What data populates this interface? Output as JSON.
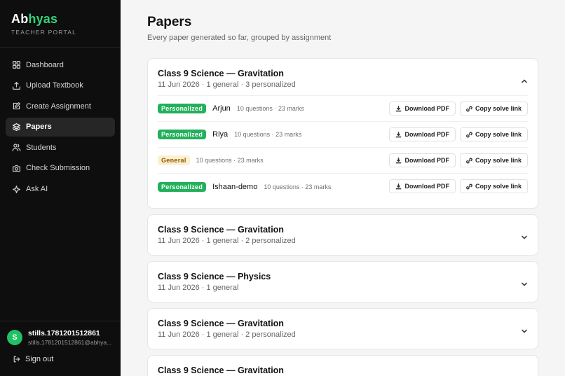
{
  "brand": {
    "name_part1": "Ab",
    "name_part2": "hyas",
    "subtitle": "TEACHER PORTAL",
    "accent_color": "#34d27b"
  },
  "sidebar": {
    "items": [
      {
        "label": "Dashboard",
        "icon": "grid-icon",
        "active": false
      },
      {
        "label": "Upload Textbook",
        "icon": "upload-icon",
        "active": false
      },
      {
        "label": "Create Assignment",
        "icon": "edit-icon",
        "active": false
      },
      {
        "label": "Papers",
        "icon": "layers-icon",
        "active": true
      },
      {
        "label": "Students",
        "icon": "users-icon",
        "active": false
      },
      {
        "label": "Check Submission",
        "icon": "camera-icon",
        "active": false
      },
      {
        "label": "Ask AI",
        "icon": "sparkle-icon",
        "active": false
      }
    ]
  },
  "user": {
    "initial": "S",
    "name": "stills.1781201512861",
    "email": "stills.1781201512861@abhya...",
    "avatar_color": "#22c065"
  },
  "signout": {
    "label": "Sign out"
  },
  "page": {
    "title": "Papers",
    "subtitle": "Every paper generated so far, grouped by assignment"
  },
  "buttons": {
    "download": "Download PDF",
    "copy": "Copy solve link"
  },
  "groups": [
    {
      "title": "Class 9 Science — Gravitation",
      "meta": "11 Jun 2026 · 1 general · 3 personalized",
      "expanded": true,
      "papers": [
        {
          "type": "Personalized",
          "student": "Arjun",
          "meta": "10 questions · 23 marks"
        },
        {
          "type": "Personalized",
          "student": "Riya",
          "meta": "10 questions · 23 marks"
        },
        {
          "type": "General",
          "student": "",
          "meta": "10 questions · 23 marks"
        },
        {
          "type": "Personalized",
          "student": "Ishaan-demo",
          "meta": "10 questions · 23 marks"
        }
      ]
    },
    {
      "title": "Class 9 Science — Gravitation",
      "meta": "11 Jun 2026 · 1 general · 2 personalized",
      "expanded": false
    },
    {
      "title": "Class 9 Science — Physics",
      "meta": "11 Jun 2026 · 1 general",
      "expanded": false
    },
    {
      "title": "Class 9 Science — Gravitation",
      "meta": "11 Jun 2026 · 1 general · 2 personalized",
      "expanded": false
    },
    {
      "title": "Class 9 Science — Gravitation",
      "meta": "",
      "expanded": false
    }
  ]
}
